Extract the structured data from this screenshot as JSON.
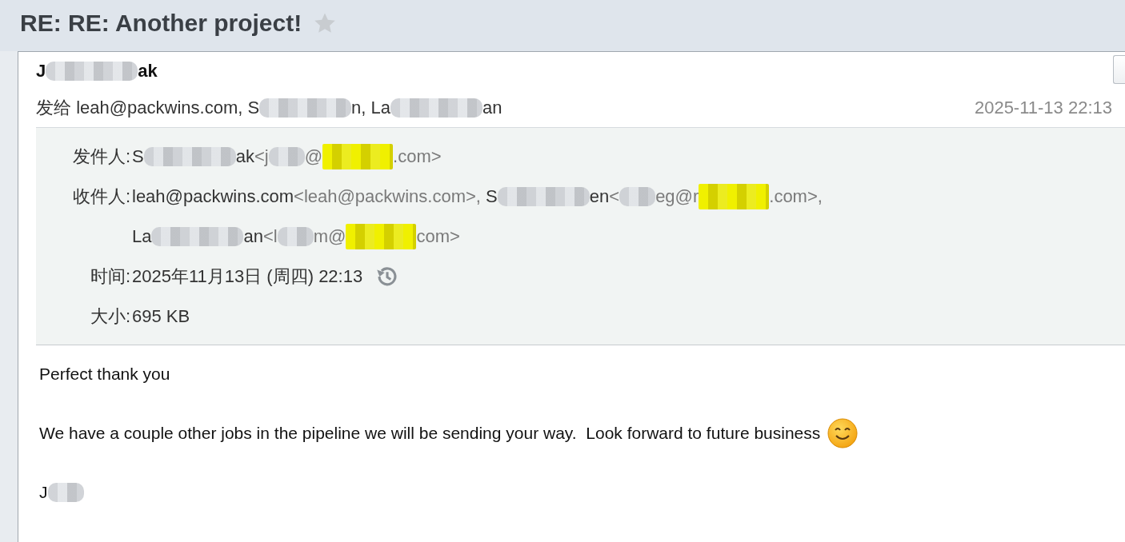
{
  "title": "RE: RE: Another project!",
  "starred": false,
  "sender_name": [
    {
      "kind": "text",
      "text": "J"
    },
    {
      "kind": "redacted_long"
    },
    {
      "kind": "text",
      "text": "ak"
    }
  ],
  "recipients_line": {
    "label": "发给",
    "segments": [
      {
        "kind": "text",
        "text": "leah@packwins.com, S"
      },
      {
        "kind": "redacted_long"
      },
      {
        "kind": "text",
        "text": "n, La"
      },
      {
        "kind": "redacted_long"
      },
      {
        "kind": "text",
        "text": "an"
      }
    ]
  },
  "date": "2025-11-13 22:13",
  "details": [
    {
      "kind": "sender",
      "label": "发件人:",
      "lines": [
        [
          {
            "kind": "text",
            "text": "S"
          },
          {
            "kind": "redacted_long"
          },
          {
            "kind": "text",
            "text": "ak"
          },
          {
            "kind": "dim",
            "text": "<j"
          },
          {
            "kind": "redacted_short"
          },
          {
            "kind": "dim",
            "text": "@"
          },
          {
            "kind": "marked"
          },
          {
            "kind": "dim",
            "text": ".com>"
          }
        ]
      ]
    },
    {
      "kind": "recipients",
      "label": "收件人:",
      "lines": [
        [
          {
            "kind": "text",
            "text": "leah@packwins.com"
          },
          {
            "kind": "dim",
            "text": "<leah@packwins.com>,"
          },
          {
            "kind": "text",
            "text": " S"
          },
          {
            "kind": "redacted_long"
          },
          {
            "kind": "text",
            "text": "en"
          },
          {
            "kind": "dim",
            "text": "<"
          },
          {
            "kind": "redacted_short"
          },
          {
            "kind": "dim",
            "text": "eg@r"
          },
          {
            "kind": "marked"
          },
          {
            "kind": "dim",
            "text": ".com>,"
          }
        ],
        [
          {
            "kind": "text",
            "text": "La"
          },
          {
            "kind": "redacted_long"
          },
          {
            "kind": "text",
            "text": "an"
          },
          {
            "kind": "dim",
            "text": "<l"
          },
          {
            "kind": "redacted_short"
          },
          {
            "kind": "dim",
            "text": "m@"
          },
          {
            "kind": "marked"
          },
          {
            "kind": "dim",
            "text": "com>"
          }
        ]
      ]
    },
    {
      "kind": "time",
      "label": "时间:",
      "lines": [
        [
          {
            "kind": "text",
            "text": "2025年11月13日 (周四) 22:13"
          }
        ]
      ]
    },
    {
      "kind": "size",
      "label": "大小:",
      "lines": [
        [
          {
            "kind": "text",
            "text": "695 KB"
          }
        ]
      ]
    }
  ],
  "body": [
    [
      {
        "kind": "text",
        "text": "Perfect thank you"
      }
    ],
    [
      {
        "kind": "text",
        "text": "We have a couple other jobs in the pipeline we will be sending your way.  Look forward to future business "
      },
      {
        "kind": "emoji"
      }
    ],
    [
      {
        "kind": "text",
        "text": "J"
      },
      {
        "kind": "redacted_short"
      }
    ]
  ]
}
